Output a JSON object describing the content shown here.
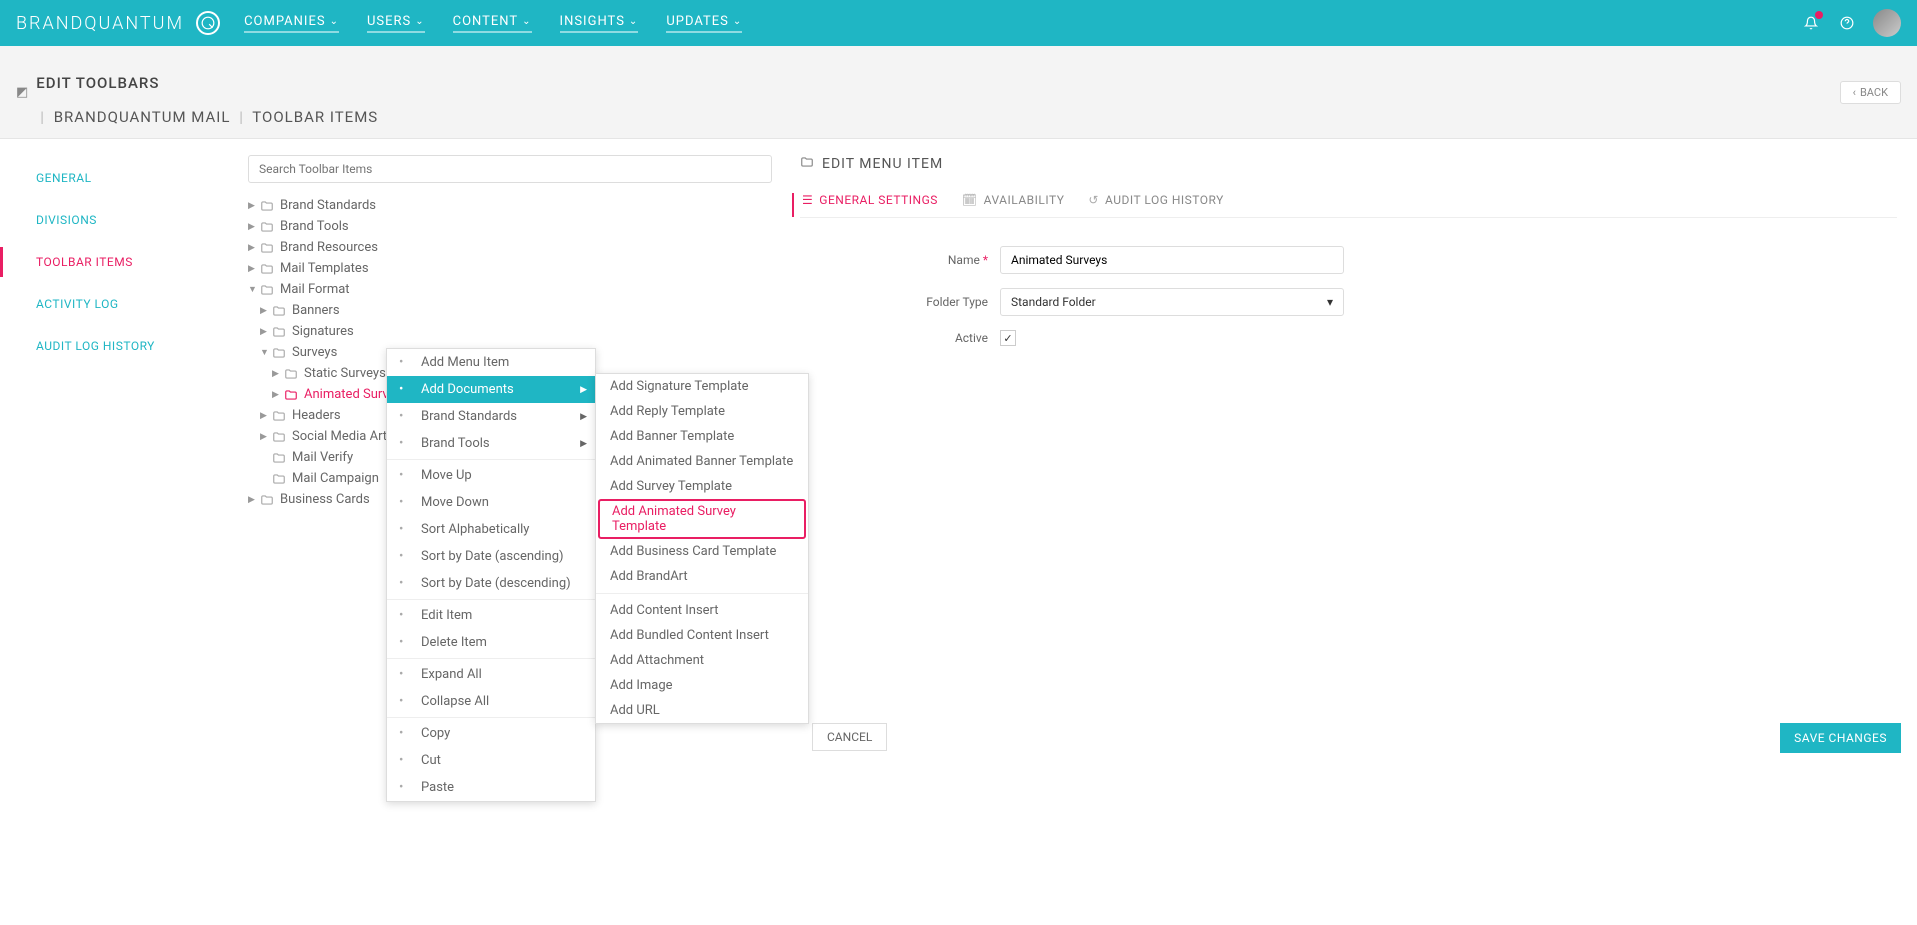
{
  "brand": "BRANDQUANTUM",
  "nav": [
    "COMPANIES",
    "USERS",
    "CONTENT",
    "INSIGHTS",
    "UPDATES"
  ],
  "crumb": {
    "title": "EDIT TOOLBARS",
    "item1": "BRANDQUANTUM MAIL",
    "item2": "TOOLBAR ITEMS",
    "back": "BACK"
  },
  "sidebar": [
    "GENERAL",
    "DIVISIONS",
    "TOOLBAR ITEMS",
    "ACTIVITY LOG",
    "AUDIT LOG HISTORY"
  ],
  "sidebarActive": 2,
  "search": {
    "placeholder": "Search Toolbar Items"
  },
  "tree": [
    {
      "label": "Brand Standards",
      "indent": 0,
      "caret": "▶"
    },
    {
      "label": "Brand Tools",
      "indent": 0,
      "caret": "▶"
    },
    {
      "label": "Brand Resources",
      "indent": 0,
      "caret": "▶"
    },
    {
      "label": "Mail Templates",
      "indent": 0,
      "caret": "▶"
    },
    {
      "label": "Mail Format",
      "indent": 0,
      "caret": "▼"
    },
    {
      "label": "Banners",
      "indent": 1,
      "caret": "▶"
    },
    {
      "label": "Signatures",
      "indent": 1,
      "caret": "▶"
    },
    {
      "label": "Surveys",
      "indent": 1,
      "caret": "▼"
    },
    {
      "label": "Static Surveys",
      "indent": 2,
      "caret": "▶"
    },
    {
      "label": "Animated Surveys",
      "indent": 2,
      "caret": "▶",
      "selected": true
    },
    {
      "label": "Headers",
      "indent": 1,
      "caret": "▶"
    },
    {
      "label": "Social Media Artw",
      "indent": 1,
      "caret": "▶",
      "truncated": true
    },
    {
      "label": "Mail Verify",
      "indent": 1,
      "caret": ""
    },
    {
      "label": "Mail Campaign",
      "indent": 1,
      "caret": ""
    },
    {
      "label": "Business Cards",
      "indent": 0,
      "caret": "▶"
    }
  ],
  "contextMenu": {
    "groups": [
      [
        {
          "label": "Add Menu Item",
          "icon": "menu"
        },
        {
          "label": "Add Documents",
          "icon": "doc",
          "hover": true,
          "arrow": true
        },
        {
          "label": "Brand Standards",
          "icon": "list",
          "arrow": true
        },
        {
          "label": "Brand Tools",
          "icon": "wrench",
          "arrow": true
        }
      ],
      [
        {
          "label": "Move Up",
          "icon": "up"
        },
        {
          "label": "Move Down",
          "icon": "down"
        },
        {
          "label": "Sort Alphabetically",
          "icon": "sort"
        },
        {
          "label": "Sort by Date (ascending)",
          "icon": "sort"
        },
        {
          "label": "Sort by Date (descending)",
          "icon": "sort"
        }
      ],
      [
        {
          "label": "Edit Item",
          "icon": "pencil"
        },
        {
          "label": "Delete Item",
          "icon": "x"
        }
      ],
      [
        {
          "label": "Expand All",
          "icon": "expand"
        },
        {
          "label": "Collapse All",
          "icon": "collapse"
        }
      ],
      [
        {
          "label": "Copy",
          "icon": "copy"
        },
        {
          "label": "Cut",
          "icon": "cut"
        },
        {
          "label": "Paste",
          "icon": "paste"
        }
      ]
    ]
  },
  "submenu": {
    "groups": [
      [
        "Add Signature Template",
        "Add Reply Template",
        "Add Banner Template",
        "Add Animated Banner Template",
        "Add Survey Template",
        "Add Animated Survey Template",
        "Add Business Card Template",
        "Add BrandArt"
      ],
      [
        "Add Content Insert",
        "Add Bundled Content Insert",
        "Add Attachment",
        "Add Image",
        "Add URL"
      ]
    ],
    "highlight": "Add Animated Survey Template"
  },
  "panel": {
    "title": "EDIT MENU ITEM",
    "tabs": [
      "GENERAL SETTINGS",
      "AVAILABILITY",
      "AUDIT LOG HISTORY"
    ],
    "activeTab": 0,
    "form": {
      "nameLabel": "Name",
      "nameValue": "Animated Surveys",
      "folderLabel": "Folder Type",
      "folderValue": "Standard Folder",
      "activeLabel": "Active",
      "activeChecked": true
    },
    "cancel": "CANCEL",
    "save": "SAVE CHANGES"
  }
}
